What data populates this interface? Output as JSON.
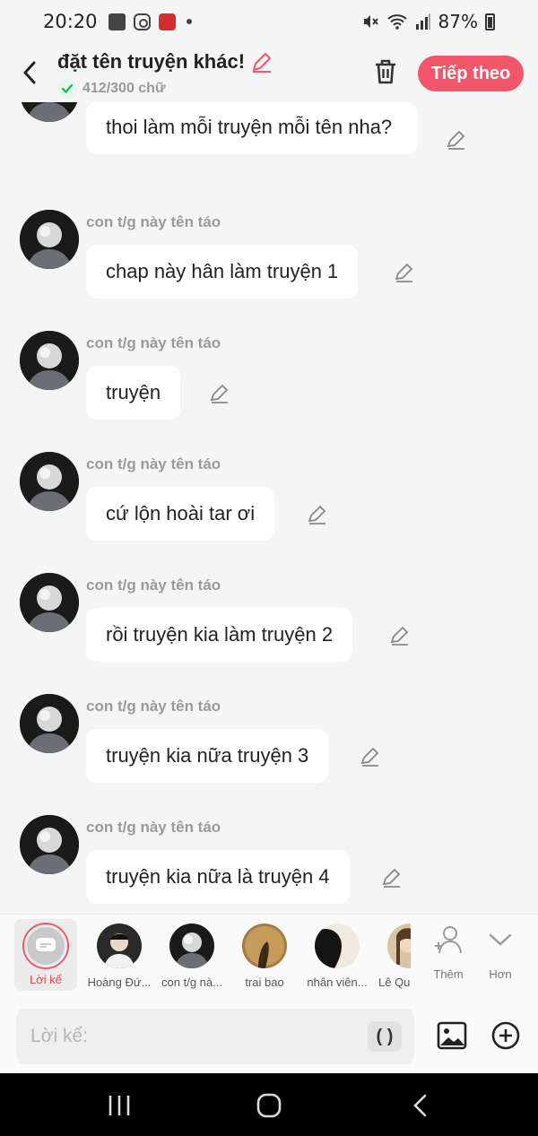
{
  "status_bar": {
    "time": "20:20",
    "battery": "87%"
  },
  "header": {
    "title": "đặt tên truyện khác!",
    "word_count": "412/300 chữ",
    "next_button": "Tiếp theo",
    "accent_color": "#f2566a"
  },
  "messages": [
    {
      "author": "",
      "text": "thoi làm mỗi truyện mỗi tên nha?"
    },
    {
      "author": "con t/g này tên táo",
      "text": "chap này hân làm truyện 1"
    },
    {
      "author": "con t/g này tên táo",
      "text": "truyện"
    },
    {
      "author": "con t/g này tên táo",
      "text": "cứ lộn hoài tar ơi"
    },
    {
      "author": "con t/g này tên táo",
      "text": "rồi truyện kia làm truyện 2"
    },
    {
      "author": "con t/g này tên táo",
      "text": "truyện kia nữa truyện 3"
    },
    {
      "author": "con t/g này tên táo",
      "text": "truyện kia nữa là truyện 4"
    }
  ],
  "characters": {
    "narrator": "Lời kể",
    "items": [
      {
        "name": "Hoàng Đứ..."
      },
      {
        "name": "con t/g nà..."
      },
      {
        "name": "trai bao"
      },
      {
        "name": "nhân viên..."
      },
      {
        "name": "Lê Qu"
      }
    ],
    "add_label": "Thêm",
    "more_label": "Hơn"
  },
  "composer": {
    "placeholder": "Lời kể:",
    "paren_label": "( )"
  }
}
